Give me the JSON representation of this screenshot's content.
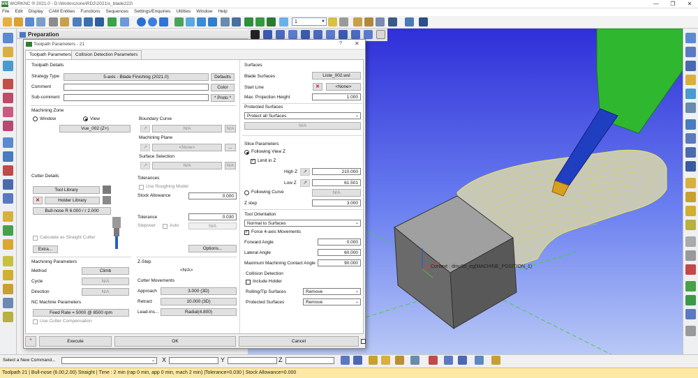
{
  "app": {
    "title": "WORKNC ® 2021.0 - D:\\Worknczone\\RD2\\2021\\s_blade222\\",
    "logo_text": "WNC"
  },
  "menu": [
    "File",
    "Edit",
    "Display",
    "CAM Entities",
    "Functions",
    "Sequences",
    "Settings/Enquiries",
    "Utilities",
    "Window",
    "Help"
  ],
  "toolbar": {
    "combo_value": "1"
  },
  "preparation": {
    "label": "Preparation"
  },
  "dialog": {
    "title": "Toolpath Parameters - 21",
    "help": "?",
    "close": "✕",
    "tabs": [
      "Toolpath Parameters",
      "Collision Detection Parameters"
    ],
    "toolpath_details": {
      "header": "Toolpath Details",
      "strategy_type_label": "Strategy Type",
      "strategy_type_value": "5-axis - Blade Finishing (2021.0)",
      "defaults_button": "Defaults",
      "comment_label": "Comment",
      "comment_value": "",
      "color_button": "Color",
      "subcomment_label": "Sub-comment",
      "subcomment_value": "",
      "proto_button": "* Proto *"
    },
    "machining_zone": {
      "header": "Machining Zone",
      "window_label": "Window",
      "view_label": "View",
      "view_value": "Vue_002 (Z+)",
      "boundary_curve_label": "Boundary Curve",
      "boundary_curve_value": "N/A",
      "boundary_curve_side": "N/A",
      "machining_plane_label": "Machining Plane",
      "machining_plane_value": "<None>",
      "machining_plane_more": "...",
      "surface_selection_label": "Surface Selection",
      "surface_selection_value": "N/A",
      "surface_selection_side": "N/A"
    },
    "cutter_details": {
      "header": "Cutter Details",
      "tool_library_button": "Tool Library",
      "holder_library_button": "Holder Library",
      "cutter_value": "Bull-nose R 6.000 / r 2.000",
      "straight_cutter_label": "Calculate as Straight Cutter",
      "extra_button": "Extra..."
    },
    "tolerances": {
      "header": "Tolerances",
      "use_roughing_label": "Use Roughing Model",
      "stock_allowance_label": "Stock Allowance",
      "stock_allowance_value": "0.000",
      "tolerance_label": "Tolerance",
      "tolerance_value": "0.030",
      "stepover_label": "Stepover",
      "auto_label": "Auto",
      "stepover_value": "N/A",
      "options_button": "Options..."
    },
    "machining_params": {
      "header": "Machining Parameters",
      "method_label": "Method",
      "method_value": "Climb",
      "cycle_label": "Cycle",
      "cycle_value": "N/A",
      "direction_label": "Direction",
      "direction_value": "N/A",
      "nc_header": "NC Machine Parameters",
      "feed_rate_button": "Feed Rate = 5000 @ 8500 rpm",
      "cutter_comp_label": "Use Cutter Compensation"
    },
    "zstep": {
      "header": "Z-Step",
      "value": "<N/A>"
    },
    "cutter_movements": {
      "header": "Cutter Movements",
      "approach_label": "Approach",
      "approach_value": "3.000 (3D)",
      "retract_label": "Retract",
      "retract_value": "10.000 (3D)",
      "leadins_label": "Lead-ins...",
      "leadins_value": "Radial(4.800)"
    },
    "surfaces": {
      "header": "Surfaces",
      "blade_surfaces_label": "Blade Surfaces",
      "blade_surfaces_value": "Liste_002.wsl",
      "start_line_label": "Start Line",
      "start_line_value": "<None>",
      "max_proj_label": "Max. Projection Height",
      "max_proj_value": "1.000",
      "protected_header": "Protected Surfaces",
      "protected_value": "Protect all Surfaces",
      "protected_na": "N/A"
    },
    "slice": {
      "header": "Slice Parameters",
      "following_view_label": "Following View Z",
      "limit_label": "Limit in Z",
      "high_z_label": "High Z",
      "high_z_value": "210.000",
      "low_z_label": "Low Z",
      "low_z_value": "61.501",
      "following_curve_label": "Following Curve",
      "following_curve_value": "N/A",
      "zstep_label": "Z step",
      "zstep_value": "3.000"
    },
    "orientation": {
      "header": "Tool Orientation",
      "value": "Normal to Surfaces",
      "force_label": "Force 4-axis Movements",
      "forward_label": "Forward Angle",
      "forward_value": "0.000",
      "lateral_label": "Lateral Angle",
      "lateral_value": "60.000",
      "max_contact_label": "Maximum Machining Contact Angle",
      "max_contact_value": "90.000"
    },
    "collision": {
      "header": "Collision Detection",
      "include_holder_label": "Include Holder",
      "rolling_label": "Rolling/Tip Surfaces",
      "rolling_value": "Remove",
      "protected_label": "Protected Surfaces",
      "protected_value": "Remove"
    },
    "footer": {
      "execute_button": "Execute",
      "ok_button": "OK",
      "cancel_button": "Cancel"
    }
  },
  "viewport": {
    "context_label": "Context : dmu95_eg(MACHINE_POSITION_1)"
  },
  "command_bar": {
    "label": "Select a New Command...",
    "x_label": "X",
    "y_label": "Y",
    "z_label": "Z"
  },
  "status": {
    "text": "Toolpath 21 | Bull-nose (6.00,2.00) Straight | Time : 2 min (rap 0 min, app 0 min, mach 2 min) |Tolerance=0.030 | Stock Allowance=0.000"
  }
}
